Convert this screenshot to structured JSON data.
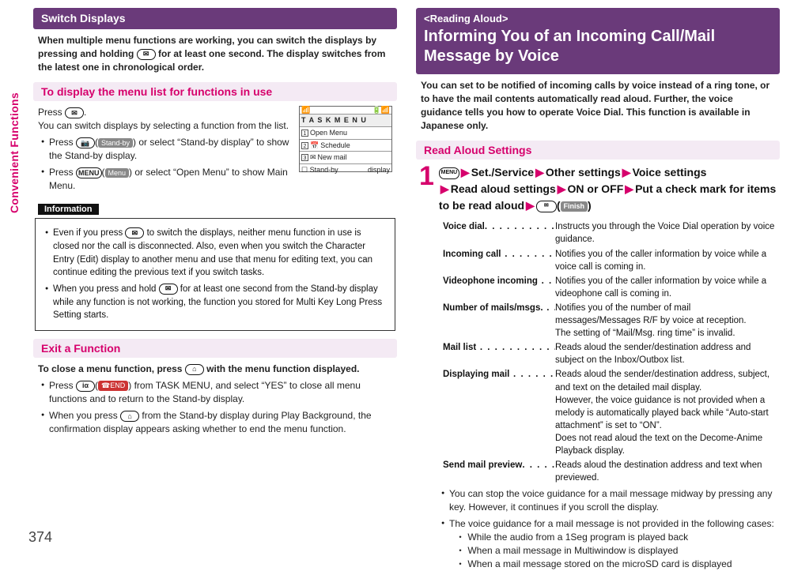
{
  "sideTab": "Convenient Functions",
  "pageNumber": "374",
  "col1": {
    "title1": "Switch Displays",
    "intro": "When multiple menu functions are working, you can switch the displays by pressing and holding ",
    "intro2": " for at least one second. The display switches from the latest one in chronological order.",
    "sub1": "To display the menu list for functions in use",
    "pressLine": "Press ",
    "pressLineB": ".",
    "switchLine": "You can switch displays by selecting a function from the list.",
    "bul1a": "Press ",
    "bul1a_btn": "Stand-by",
    "bul1b": " or select “Stand-by display” to show the Stand-by display.",
    "bul2a": "Press ",
    "bul2a_btn": "Menu",
    "bul2b": " or select “Open Menu” to show Main Menu.",
    "infoLabel": "Information",
    "info1": "Even if you press ",
    "info1b": " to switch the displays, neither menu function in use is closed nor the call is disconnected. Also, even when you switch the Character Entry (Edit) display to another menu and use that menu for editing text, you can continue editing the previous text if you switch tasks.",
    "info2": "When you press and hold ",
    "info2b": " for at least one second from the Stand-by display while any function is not working, the function you stored for Multi Key Long Press Setting starts.",
    "title2": "Exit a Function",
    "close1": "To close a menu function, press ",
    "close1b": " with the menu function displayed.",
    "bul3a": "Press ",
    "bul3a_btn": "END",
    "bul3b": " from TASK MENU, and select “YES” to close all menu functions and to return to the Stand-by display.",
    "bul4a": "When you press ",
    "bul4b": " from the Stand-by display during Play Background, the confirmation display appears asking whether to end the menu function.",
    "phone": {
      "title": "T A S K  M E N U",
      "r1": "Open Menu",
      "r2": "Schedule",
      "r3": "New mail",
      "f1": "Stand-by",
      "f2": "display"
    }
  },
  "col2": {
    "tag": "<Reading Aloud>",
    "title": "Informing You of an Incoming Call/Mail Message by Voice",
    "intro": "You can set to be notified of incoming calls by voice instead of a ring tone, or to have the mail contents automatically read aloud. Further, the voice guidance tells you how to operate Voice Dial. This function is available in Japanese only.",
    "sub": "Read Aloud Settings",
    "menuBtn": "MENU",
    "chain1": "Set./Service",
    "chain2": "Other settings",
    "chain3": "Voice settings",
    "chain4": "Read aloud settings",
    "chain5": "ON or OFF",
    "chain6": "Put a check mark for items to be read aloud",
    "finish": "Finish",
    "items": [
      {
        "k": "Voice dial",
        "d": ". . . . . . . . . . . . . . .",
        "v": "Instructs you through the Voice Dial operation by voice guidance."
      },
      {
        "k": "Incoming call",
        "d": " . . . . . . . . . . . .",
        "v": "Notifies you of the caller information by voice while a voice call is coming in."
      },
      {
        "k": "Videophone incoming",
        "d": " . . . .",
        "v": "Notifies you of the caller information by voice while a videophone call is coming in."
      },
      {
        "k": "Number of mails/msgs.",
        "d": " . . .",
        "v": "Notifies you of the number of mail messages/Messages R/F by voice at reception.\nThe setting of “Mail/Msg. ring time” is invalid."
      },
      {
        "k": "Mail list",
        "d": " . . . . . . . . . . . . . . . . .",
        "v": "Reads aloud the sender/destination address and subject on the Inbox/Outbox list."
      },
      {
        "k": "Displaying mail",
        "d": " . . . . . . . . . .",
        "v": "Reads aloud the sender/destination address, subject, and text on the detailed mail display.\nHowever, the voice guidance is not provided when a melody is automatically played back while “Auto-start attachment” is set to “ON”.\nDoes not read aloud the text on the Decome-Anime Playback display."
      },
      {
        "k": "Send mail preview",
        "d": ". . . . . . . .",
        "v": "Reads aloud the destination address and text when previewed."
      }
    ],
    "note1": "You can stop the voice guidance for a mail message midway by pressing any key. However, it continues if you scroll the display.",
    "note2": "The voice guidance for a mail message is not provided in the following cases:",
    "case1": "While the audio from a 1Seg program is played back",
    "case2": "When a mail message in Multiwindow is displayed",
    "case3": "When a mail message stored on the microSD card is displayed"
  }
}
